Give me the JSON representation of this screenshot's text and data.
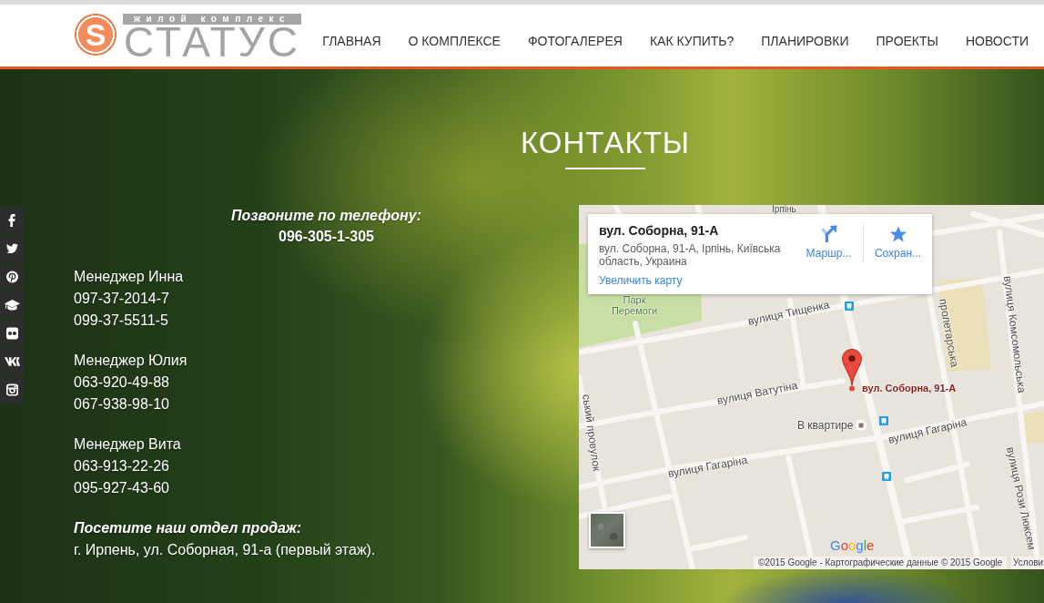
{
  "header": {
    "logo": {
      "mark": "S",
      "tagline": "жилой комплекс",
      "name": "СТАТУС"
    },
    "nav": [
      {
        "label": "ГЛАВНАЯ",
        "selected": false
      },
      {
        "label": "О КОМПЛЕКСЕ",
        "selected": false
      },
      {
        "label": "ФОТОГАЛЕРЕЯ",
        "selected": false
      },
      {
        "label": "КАК КУПИТЬ?",
        "selected": false
      },
      {
        "label": "ПЛАНИРОВКИ",
        "selected": false
      },
      {
        "label": "ПРОЕКТЫ",
        "selected": false
      },
      {
        "label": "НОВОСТИ",
        "selected": false
      }
    ]
  },
  "social_links": [
    {
      "kind": "facebook"
    },
    {
      "kind": "twitter"
    },
    {
      "kind": "pinterest"
    },
    {
      "kind": "education"
    },
    {
      "kind": "flickr"
    },
    {
      "kind": "vk"
    },
    {
      "kind": "instagram"
    }
  ],
  "page_title": "КОНТАКТЫ",
  "contacts": {
    "call": {
      "label": "Позвоните по телефону:",
      "phone": "096-305-1-305"
    },
    "managers": [
      {
        "name": "Менеджер Инна",
        "phones": [
          "097-37-2014-7",
          "099-37-5511-5"
        ]
      },
      {
        "name": "Менеджер Юлия",
        "phones": [
          "063-920-49-88",
          "067-938-98-10"
        ]
      },
      {
        "name": "Менеджер Вита",
        "phones": [
          "063-913-22-26",
          "095-927-43-60"
        ]
      }
    ],
    "office": {
      "label": "Посетите наш отдел продаж:",
      "address": "г. Ирпень, ул. Соборная, 91-а (первый этаж)."
    }
  },
  "map": {
    "info_card": {
      "title": "вул. Соборна, 91-А",
      "address": "вул. Соборна, 91-А, Ірпінь, Київська область, Украина",
      "link": "Увеличить карту",
      "actions": [
        {
          "kind": "directions",
          "label": "Маршр..."
        },
        {
          "kind": "save",
          "label": "Сохран..."
        }
      ]
    },
    "labels": [
      {
        "kind": "town",
        "text": "Ірпінь"
      },
      {
        "kind": "park",
        "text": "Парк Перемоги"
      },
      {
        "kind": "street",
        "text": "вулиця Тищенка"
      },
      {
        "kind": "street",
        "text": "пролетарська"
      },
      {
        "kind": "street",
        "text": "вулиця Комсомольська"
      },
      {
        "kind": "street",
        "text": "вулиця Ватутіна"
      },
      {
        "kind": "place",
        "text": "В квартире"
      },
      {
        "kind": "street",
        "text": "вулиця Гагаріна"
      },
      {
        "kind": "street",
        "text": "вулиця Гагаріна"
      },
      {
        "kind": "street",
        "text": "ський провулок"
      },
      {
        "kind": "street",
        "text": "вулиця Рози Люксем"
      }
    ],
    "marker": {
      "label": "вул. Соборна, 91-А"
    },
    "logo": "Google",
    "attribution": "©2015 Google - Картографические данные © 2015 Google",
    "terms": "Услови"
  }
}
